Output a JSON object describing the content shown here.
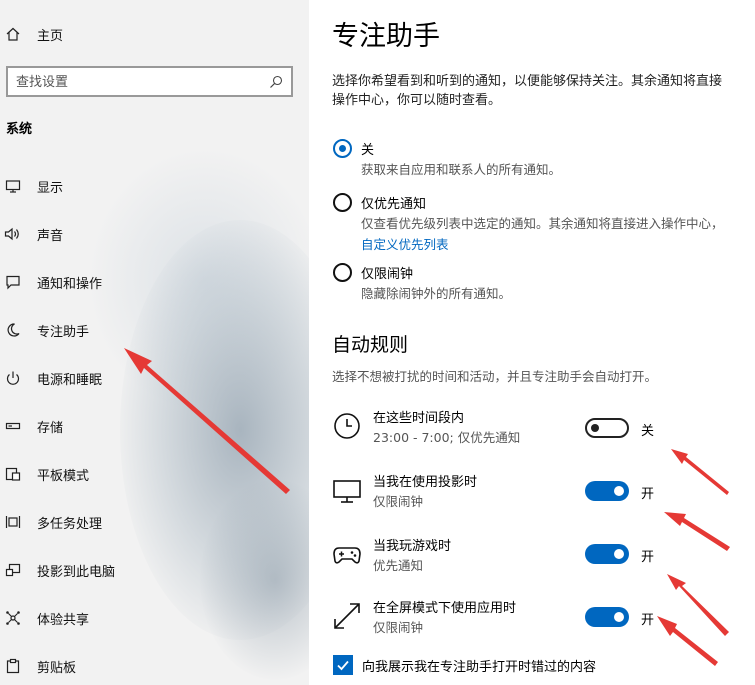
{
  "sidebar": {
    "home_label": "主页",
    "search_placeholder": "查找设置",
    "section_title": "系统",
    "items": [
      {
        "label": "显示",
        "icon": "monitor-icon"
      },
      {
        "label": "声音",
        "icon": "speaker-icon"
      },
      {
        "label": "通知和操作",
        "icon": "notification-icon"
      },
      {
        "label": "专注助手",
        "icon": "moon-icon"
      },
      {
        "label": "电源和睡眠",
        "icon": "power-icon"
      },
      {
        "label": "存储",
        "icon": "storage-icon"
      },
      {
        "label": "平板模式",
        "icon": "tablet-mode-icon"
      },
      {
        "label": "多任务处理",
        "icon": "multitasking-icon"
      },
      {
        "label": "投影到此电脑",
        "icon": "project-icon"
      },
      {
        "label": "体验共享",
        "icon": "share-icon"
      },
      {
        "label": "剪贴板",
        "icon": "clipboard-icon"
      }
    ]
  },
  "main": {
    "title": "专注助手",
    "description_line1": "选择你希望看到和听到的通知，以便能够保持关注。其余通知将直接",
    "description_line2": "操作中心，你可以随时查看。",
    "options": [
      {
        "label": "关",
        "sub": "获取来自应用和联系人的所有通知。",
        "checked": true
      },
      {
        "label": "仅优先通知",
        "sub": "仅查看优先级列表中选定的通知。其余通知将直接进入操作中心，",
        "link": "自定义优先列表",
        "checked": false
      },
      {
        "label": "仅限闹钟",
        "sub": "隐藏除闹钟外的所有通知。",
        "checked": false
      }
    ],
    "auto_rules_title": "自动规则",
    "auto_rules_desc": "选择不想被打扰的时间和活动，并且专注助手会自动打开。",
    "rules": [
      {
        "title": "在这些时间段内",
        "sub": "23:00 - 7:00; 仅优先通知",
        "state": "关",
        "on": false,
        "icon": "clock-icon"
      },
      {
        "title": "当我在使用投影时",
        "sub": "仅限闹钟",
        "state": "开",
        "on": true,
        "icon": "monitor-icon"
      },
      {
        "title": "当我玩游戏时",
        "sub": "优先通知",
        "state": "开",
        "on": true,
        "icon": "gamepad-icon"
      },
      {
        "title": "在全屏模式下使用应用时",
        "sub": "仅限闹钟",
        "state": "开",
        "on": true,
        "icon": "fullscreen-icon"
      }
    ],
    "checkbox_label": "向我展示我在专注助手打开时错过的内容"
  },
  "colors": {
    "accent": "#0067c0",
    "annotation_arrow": "#e53935",
    "sidebar_bg": "#f2f2f2"
  }
}
